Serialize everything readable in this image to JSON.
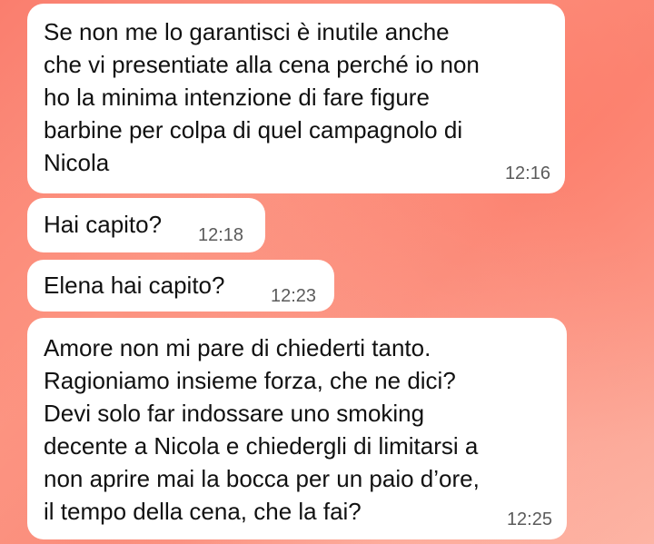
{
  "messages": [
    {
      "text": "Se non me lo garantisci è inutile anche\nche vi presentiate alla cena perché io non\nho la minima intenzione di fare figure\nbarbine per colpa di quel campagnolo di\nNicola",
      "time": "12:16"
    },
    {
      "text": "Hai capito?",
      "time": "12:18"
    },
    {
      "text": "Elena hai capito?",
      "time": "12:23"
    },
    {
      "text": "Amore non mi pare di chiederti tanto.\nRagioniamo insieme forza, che ne dici?\nDevi solo far indossare uno smoking\ndecente a Nicola e chiedergli di limitarsi a\nnon aprire mai la bocca per un paio d’ore,\nil tempo della cena, che la fai?",
      "time": "12:25"
    }
  ],
  "colors": {
    "bubble": "#ffffff",
    "text": "#111111",
    "timestamp": "#5b5b5b",
    "background_accent": "#fa7e6e"
  }
}
